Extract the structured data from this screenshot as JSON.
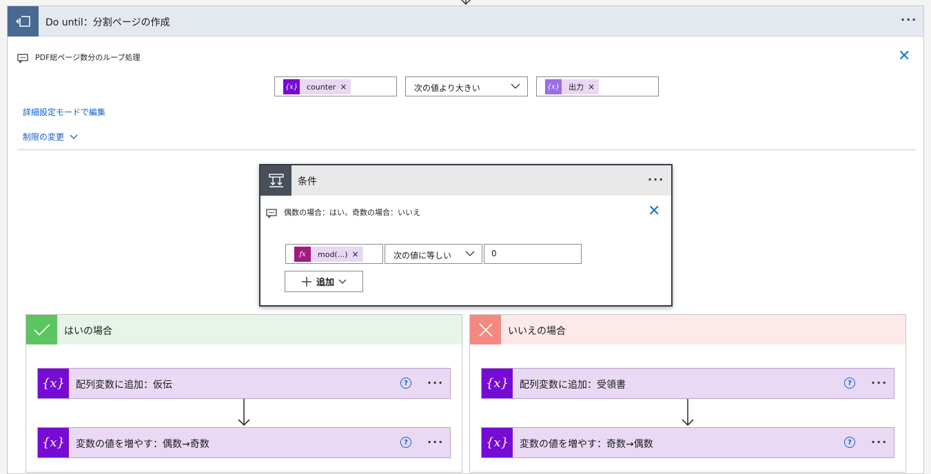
{
  "do_until": {
    "title": "Do until：分割ページの作成",
    "comment": "PDF総ページ数分のループ処理",
    "condition": {
      "left_token": "counter",
      "operator": "次の値より大きい",
      "right_token": "出力"
    },
    "advanced_link": "詳細設定モードで編集",
    "limits_link": "制限の変更"
  },
  "condition_card": {
    "title": "条件",
    "comment": "偶数の場合：はい、奇数の場合：いいえ",
    "row": {
      "left_token": "mod(...)",
      "operator": "次の値に等しい",
      "value": "0"
    },
    "add_button": "追加"
  },
  "yes_branch": {
    "title": "はいの場合",
    "actions": [
      {
        "title": "配列変数に追加：仮伝"
      },
      {
        "title": "変数の値を増やす：偶数→奇数"
      }
    ]
  },
  "no_branch": {
    "title": "いいえの場合",
    "actions": [
      {
        "title": "配列変数に追加：受領書"
      },
      {
        "title": "変数の値を増やす：奇数→偶数"
      }
    ]
  },
  "colors": {
    "until_header_bg": "#e4e8ef",
    "until_icon_bg": "#486991",
    "condition_icon_bg": "#484f58",
    "variable_purple": "#770bd6",
    "expression_magenta": "#a4197e",
    "yes_green": "#5cc461",
    "yes_bg": "#e7f5e9",
    "no_red": "#f38981",
    "no_bg": "#fce9e9",
    "link_blue": "#0e5fcc"
  }
}
